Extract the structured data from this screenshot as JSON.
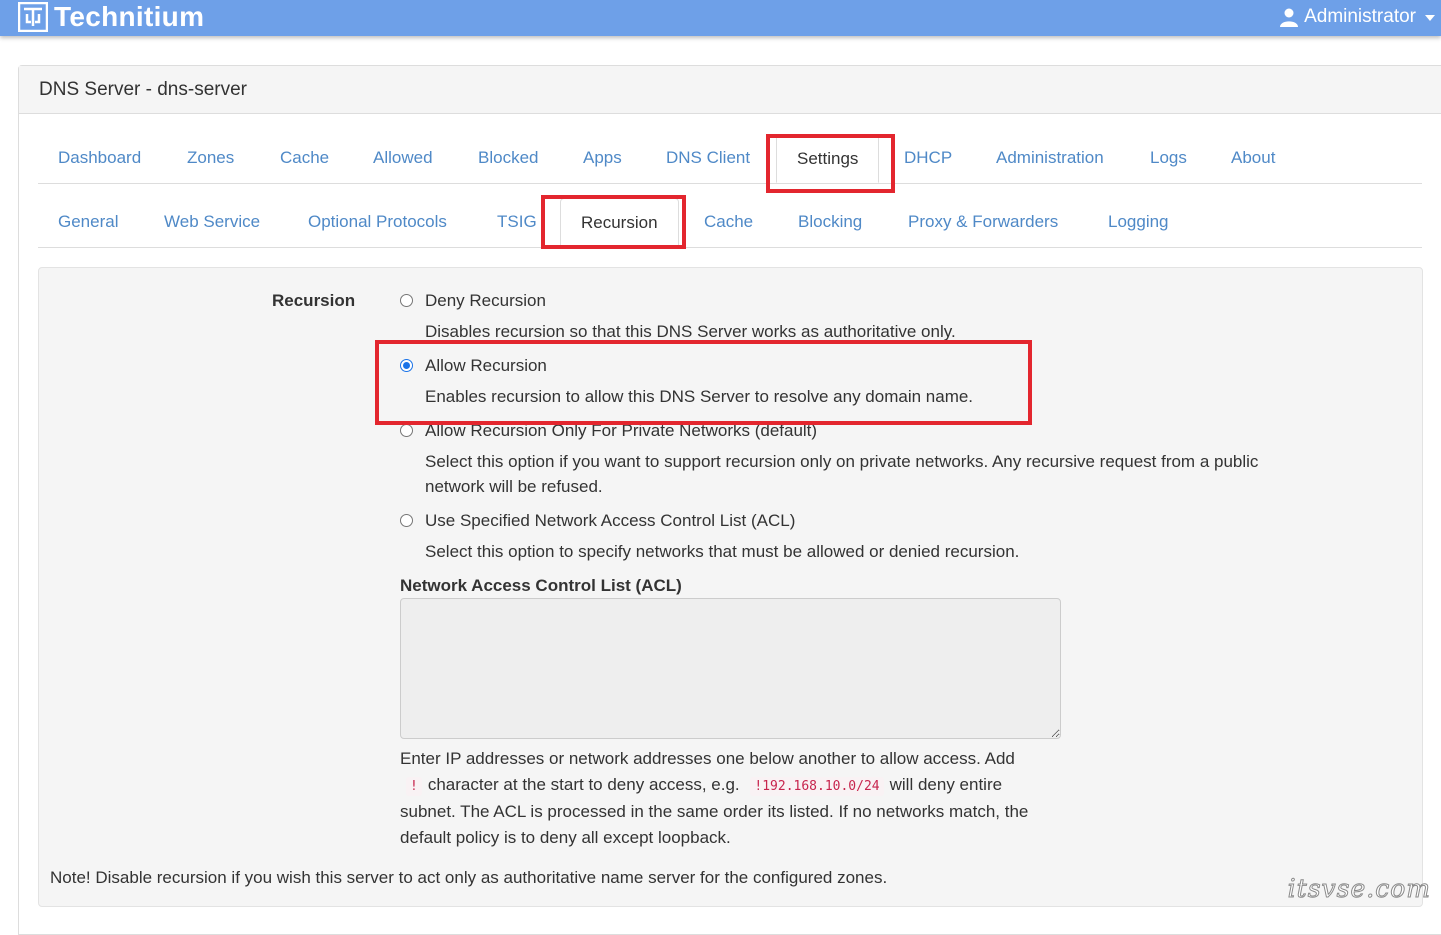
{
  "header": {
    "brand": "Technitium",
    "user": "Administrator",
    "icons": {
      "logo": "technitium-logo-icon",
      "user": "user-icon",
      "caret": "caret-down-icon"
    }
  },
  "panel": {
    "title": "DNS Server - dns-server"
  },
  "main_tabs": [
    {
      "label": "Dashboard",
      "active": false
    },
    {
      "label": "Zones",
      "active": false
    },
    {
      "label": "Cache",
      "active": false
    },
    {
      "label": "Allowed",
      "active": false
    },
    {
      "label": "Blocked",
      "active": false
    },
    {
      "label": "Apps",
      "active": false
    },
    {
      "label": "DNS Client",
      "active": false
    },
    {
      "label": "Settings",
      "active": true
    },
    {
      "label": "DHCP",
      "active": false
    },
    {
      "label": "Administration",
      "active": false
    },
    {
      "label": "Logs",
      "active": false
    },
    {
      "label": "About",
      "active": false
    }
  ],
  "settings_tabs": [
    {
      "label": "General",
      "active": false
    },
    {
      "label": "Web Service",
      "active": false
    },
    {
      "label": "Optional Protocols",
      "active": false
    },
    {
      "label": "TSIG",
      "active": false
    },
    {
      "label": "Recursion",
      "active": true
    },
    {
      "label": "Cache",
      "active": false
    },
    {
      "label": "Blocking",
      "active": false
    },
    {
      "label": "Proxy & Forwarders",
      "active": false
    },
    {
      "label": "Logging",
      "active": false
    }
  ],
  "recursion": {
    "label": "Recursion",
    "options": [
      {
        "label": "Deny Recursion",
        "help": "Disables recursion so that this DNS Server works as authoritative only.",
        "checked": false
      },
      {
        "label": "Allow Recursion",
        "help": "Enables recursion to allow this DNS Server to resolve any domain name.",
        "checked": true
      },
      {
        "label": "Allow Recursion Only For Private Networks (default)",
        "help": "Select this option if you want to support recursion only on private networks. Any recursive request from a public network will be refused.",
        "checked": false
      },
      {
        "label": "Use Specified Network Access Control List (ACL)",
        "help": "Select this option to specify networks that must be allowed or denied recursion.",
        "checked": false
      }
    ],
    "acl": {
      "title": "Network Access Control List (ACL)",
      "value": "",
      "help_1": "Enter IP addresses or network addresses one below another to allow access. Add",
      "code_1": "!",
      "help_2": "character at the start to deny access, e.g.",
      "code_2": "!192.168.10.0/24",
      "help_3": "will deny entire subnet. The ACL is processed in the same order its listed. If no networks match, the default policy is to deny all except loopback."
    },
    "note": "Note! Disable recursion if you wish this server to act only as authoritative name server for the configured zones."
  },
  "highlight_color": "#e3262e",
  "watermark": "itsvse.com"
}
